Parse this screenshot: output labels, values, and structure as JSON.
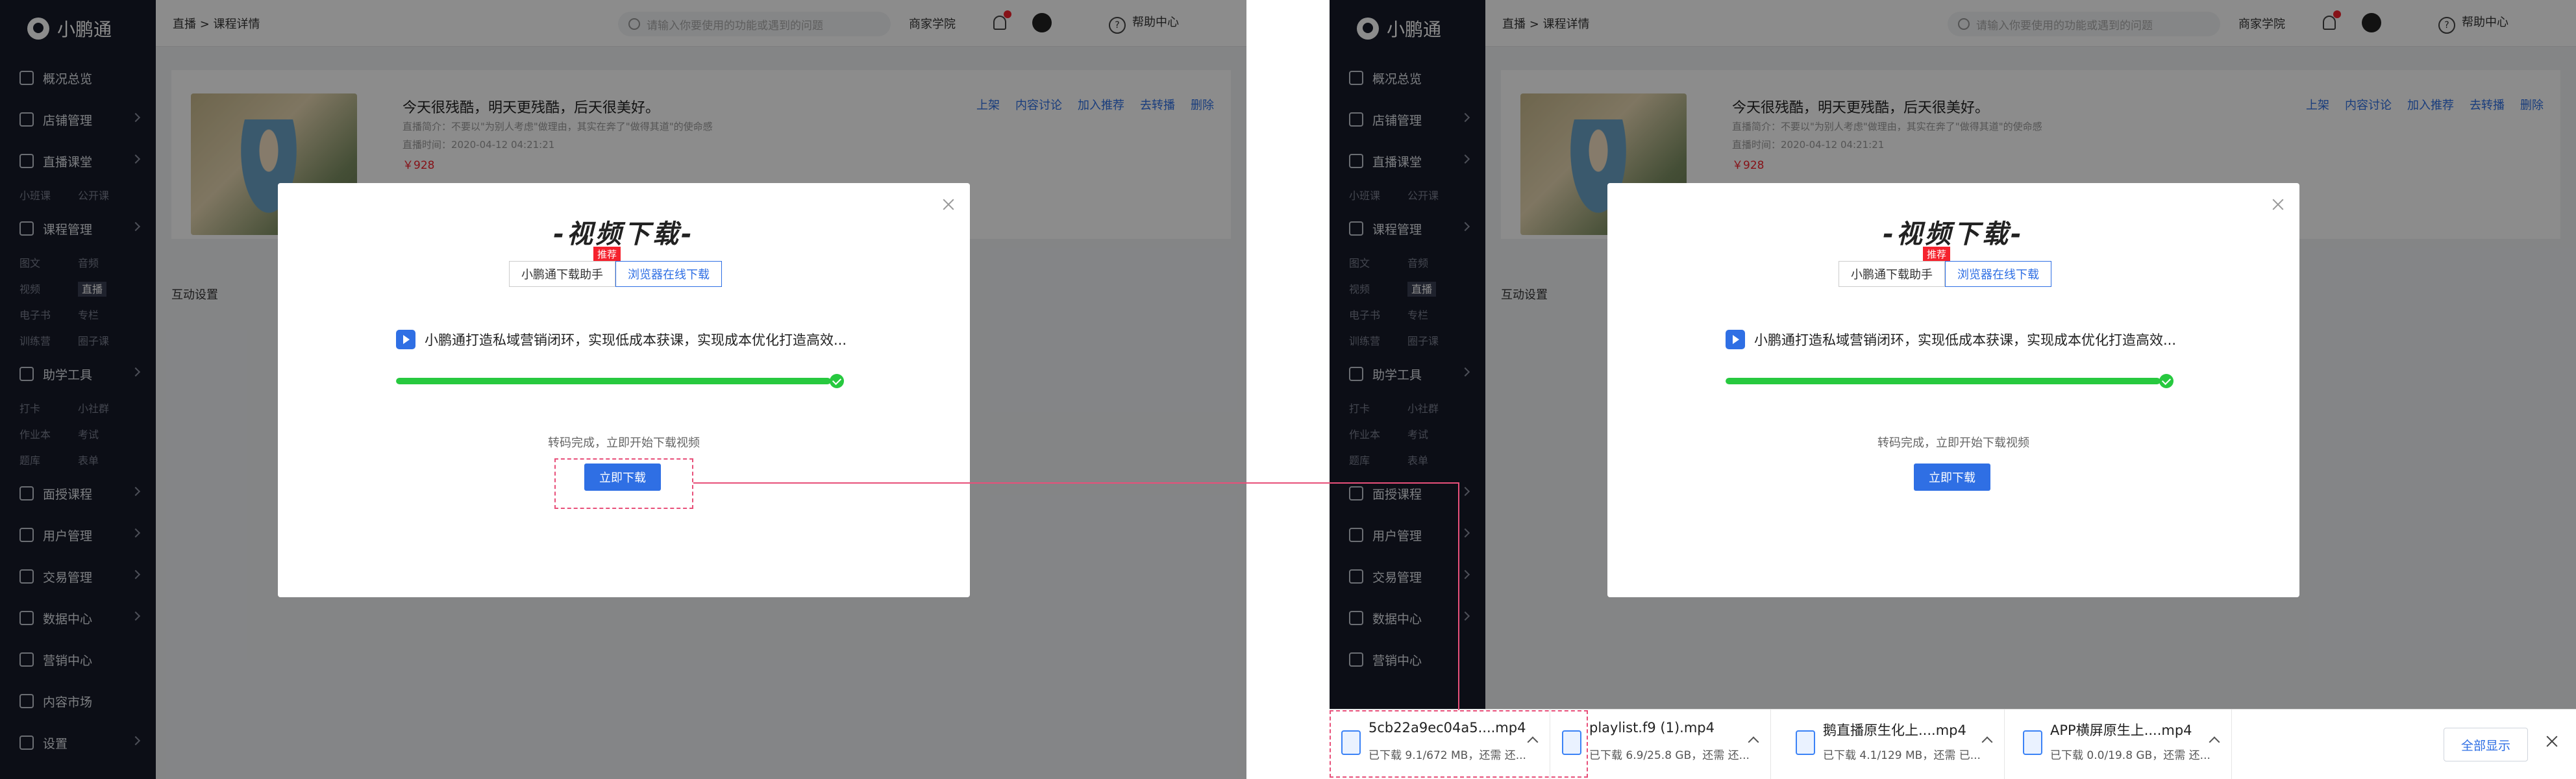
{
  "app": {
    "logo_text": "小鹏通",
    "breadcrumb": "直播 > 课程详情",
    "search_placeholder": "请输入你要使用的功能或遇到的问题",
    "business_school": "商家学院",
    "help_center": "帮助中心"
  },
  "sidebar": {
    "items": [
      {
        "label": "概况总览"
      },
      {
        "label": "店铺管理"
      },
      {
        "label": "直播课堂",
        "sub": [
          "小班课",
          "公开课"
        ]
      },
      {
        "label": "课程管理",
        "sub": [
          "图文",
          "音频",
          "视频",
          "直播",
          "电子书",
          "专栏",
          "训练营",
          "圈子课"
        ]
      },
      {
        "label": "助学工具",
        "sub": [
          "打卡",
          "小社群",
          "作业本",
          "考试",
          "题库",
          "表单"
        ]
      },
      {
        "label": "面授课程"
      },
      {
        "label": "用户管理"
      },
      {
        "label": "交易管理"
      },
      {
        "label": "数据中心"
      },
      {
        "label": "营销中心"
      },
      {
        "label": "内容市场"
      },
      {
        "label": "设置"
      }
    ]
  },
  "course": {
    "title": "今天很残酷，明天更残酷，后天很美好。",
    "intro": "直播简介：不要以\"为别人考虑\"做理由，其实在奔了\"做得其道\"的使命感",
    "time": "直播时间：2020-04-12 04:21:21",
    "price": "￥928",
    "actions": [
      "上架",
      "内容讨论",
      "加入推荐",
      "去转播",
      "删除"
    ]
  },
  "tab_interactive": "互动设置",
  "modal": {
    "title": "-视频下载-",
    "tab_helper": "小鹏通下载助手",
    "tab_browser": "浏览器在线下载",
    "recommend_badge": "推荐",
    "task_text": "小鹏通打造私域营销闭环，实现低成本获课，实现成本优化打造高效...",
    "progress_percent": 100,
    "status_text": "转码完成，立即开始下载视频",
    "download_button": "立即下载"
  },
  "downloads": {
    "items": [
      {
        "name": "5cb22a9ec04a5....mp4",
        "status": "已下载 9.1/672 MB，还需 还..."
      },
      {
        "name": "playlist.f9 (1).mp4",
        "status": "已下载 6.9/25.8 GB，还需 还..."
      },
      {
        "name": "鹅直播原生化上....mp4",
        "status": "已下载 4.1/129 MB，还需 已..."
      },
      {
        "name": "APP横屏原生上....mp4",
        "status": "已下载 0.0/19.8 GB，还需 还..."
      }
    ],
    "show_all": "全部显示"
  },
  "colors": {
    "accent": "#2f6fe4",
    "success": "#27c93f",
    "danger": "#f5222d",
    "annotation": "#e8507a",
    "sidebar_bg": "#161a29"
  }
}
